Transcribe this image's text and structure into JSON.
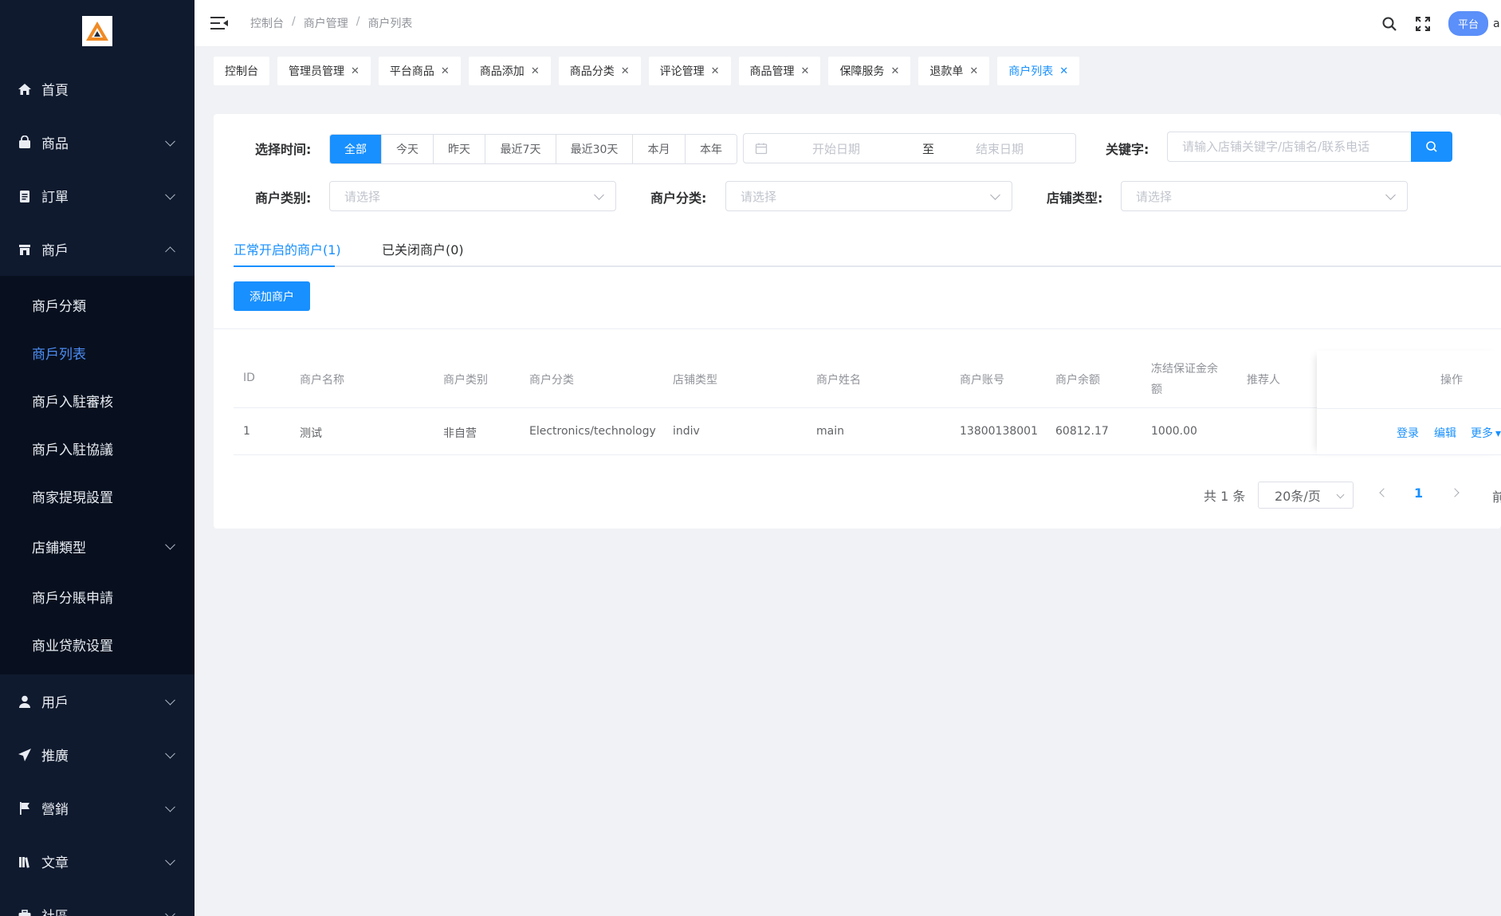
{
  "sidebar": {
    "items": [
      {
        "label": "首頁",
        "icon": "home-icon"
      },
      {
        "label": "商品",
        "icon": "shopping-bag-icon"
      },
      {
        "label": "訂單",
        "icon": "clipboard-icon"
      },
      {
        "label": "商戶",
        "icon": "store-icon"
      },
      {
        "label": "用戶",
        "icon": "user-icon"
      },
      {
        "label": "推廣",
        "icon": "send-icon"
      },
      {
        "label": "營銷",
        "icon": "flag-icon"
      },
      {
        "label": "文章",
        "icon": "book-icon"
      },
      {
        "label": "社區",
        "icon": "briefcase-icon"
      }
    ],
    "submenu": [
      {
        "label": "商戶分類"
      },
      {
        "label": "商戶列表"
      },
      {
        "label": "商戶入駐審核"
      },
      {
        "label": "商戶入駐協議"
      },
      {
        "label": "商家提現設置"
      },
      {
        "label": "店鋪類型"
      },
      {
        "label": "商戶分賬申請"
      },
      {
        "label": "商业贷款设置"
      }
    ]
  },
  "header": {
    "breadcrumb": [
      "控制台",
      "商户管理",
      "商户列表"
    ],
    "separator": "/",
    "badge": "平台",
    "user_initial": "a"
  },
  "tags": [
    {
      "label": "控制台",
      "closable": false
    },
    {
      "label": "管理员管理",
      "closable": true
    },
    {
      "label": "平台商品",
      "closable": true
    },
    {
      "label": "商品添加",
      "closable": true
    },
    {
      "label": "商品分类",
      "closable": true
    },
    {
      "label": "评论管理",
      "closable": true
    },
    {
      "label": "商品管理",
      "closable": true
    },
    {
      "label": "保障服务",
      "closable": true
    },
    {
      "label": "退款单",
      "closable": true
    },
    {
      "label": "商户列表",
      "closable": true,
      "active": true
    }
  ],
  "filters": {
    "time_label": "选择时间:",
    "time_options": [
      "全部",
      "今天",
      "昨天",
      "最近7天",
      "最近30天",
      "本月",
      "本年"
    ],
    "time_selected": "全部",
    "date_start_placeholder": "开始日期",
    "date_to": "至",
    "date_end_placeholder": "结束日期",
    "keyword_label": "关键字:",
    "keyword_placeholder": "请输入店铺关键字/店铺名/联系电话",
    "merchant_type_label": "商户类别:",
    "merchant_category_label": "商户分类:",
    "shop_type_label": "店铺类型:",
    "select_placeholder": "请选择"
  },
  "tabs": {
    "open": "正常开启的商户(1)",
    "closed": "已关闭商户(0)"
  },
  "add_button": "添加商户",
  "table": {
    "headers": {
      "id": "ID",
      "name": "商户名称",
      "type": "商户类别",
      "category": "商户分类",
      "shop_type": "店铺类型",
      "owner": "商户姓名",
      "account": "商户账号",
      "balance": "商户余额",
      "frozen_1": "冻结保证金余",
      "frozen_2": "额",
      "referrer": "推荐人",
      "ops": "操作"
    },
    "rows": [
      {
        "id": "1",
        "name": "测试",
        "type": "非自营",
        "category": "Electronics/technology",
        "shop_type": "indiv",
        "owner": "main",
        "account": "13800138001",
        "balance": "60812.17",
        "frozen": "1000.00",
        "referrer": "",
        "ops": [
          "登录",
          "编辑",
          "更多"
        ]
      }
    ]
  },
  "pagination": {
    "total": "共 1 条",
    "page_size": "20条/页",
    "current": "1",
    "goto": "前往"
  }
}
